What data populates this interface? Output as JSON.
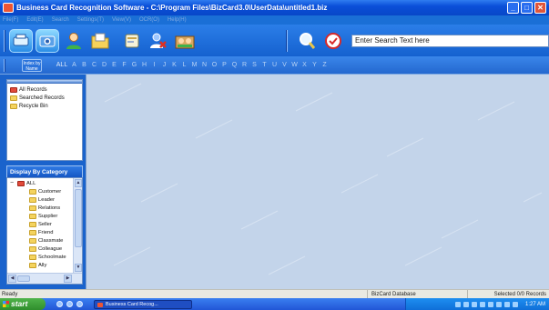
{
  "window": {
    "title": "Business Card Recognition Software - C:\\Program Files\\BizCard3.0\\UserData\\untitled1.biz",
    "controls": [
      "minimize",
      "maximize",
      "close"
    ]
  },
  "menu": [
    "File(F)",
    "Edit(E)",
    "Search",
    "Settings(T)",
    "View(V)",
    "OCR(O)",
    "Help(H)"
  ],
  "toolbar": {
    "buttons": [
      "scan-icon",
      "camera-icon",
      "add-contact-icon",
      "open-folder-icon",
      "card-icon",
      "delete-contact-icon",
      "contacts-icon",
      "search-icon",
      "filter-icon"
    ],
    "search_value": "Enter Search Text here"
  },
  "alphabar": {
    "index_label_line1": "Index by",
    "index_label_line2": "Name",
    "letters": [
      "ALL",
      "A",
      "B",
      "C",
      "D",
      "E",
      "F",
      "G",
      "H",
      "I",
      "J",
      "K",
      "L",
      "M",
      "N",
      "O",
      "P",
      "Q",
      "R",
      "S",
      "T",
      "U",
      "V",
      "W",
      "X",
      "Y",
      "Z"
    ]
  },
  "records": {
    "items": [
      "All Records",
      "Searched Records",
      "Recycle Bin"
    ]
  },
  "category": {
    "header": "Display By Category",
    "root": "ALL",
    "items": [
      "Customer",
      "Leader",
      "Relations",
      "Supplier",
      "Seller",
      "Friend",
      "Classmate",
      "Colleague",
      "Schoolmate",
      "Ally"
    ]
  },
  "status": {
    "ready": "Ready",
    "db": "BizCard Database",
    "records": "Selected 0/0 Records"
  },
  "taskbar": {
    "start": "start",
    "task": "Business Card Recog...",
    "clock": "1:27 AM"
  }
}
